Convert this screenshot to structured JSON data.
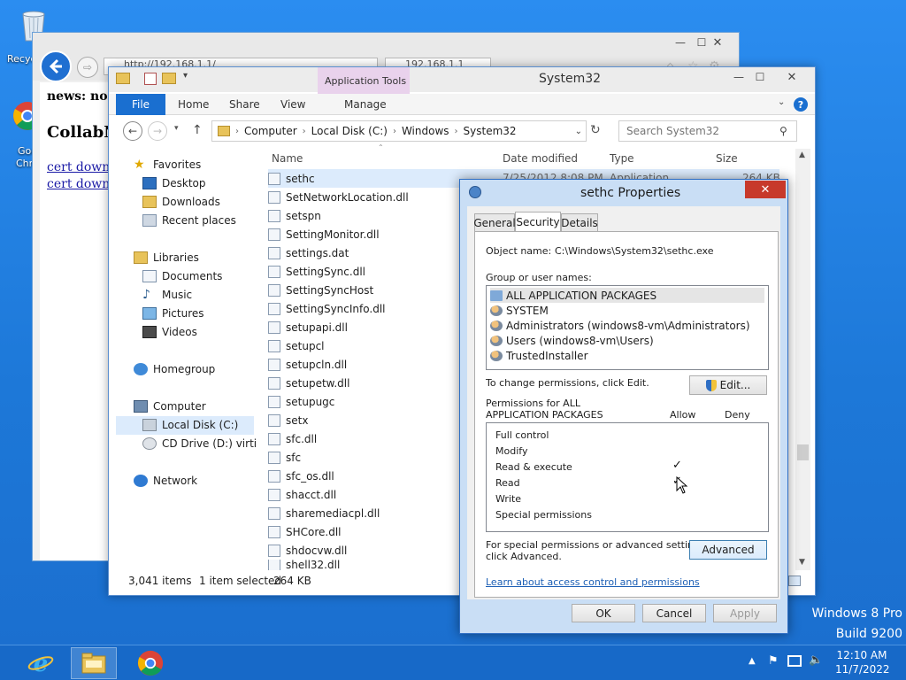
{
  "desktop": {
    "icons": [
      {
        "label": "Recyc"
      },
      {
        "label": "Goo"
      },
      {
        "label": "Chro"
      }
    ],
    "watermark": {
      "line1": "Windows 8 Pro",
      "line2": "Build 9200"
    }
  },
  "browser": {
    "address": "http://192.168.1.1/",
    "tab_address": "192.168.1.1",
    "page": {
      "news": "news: no n",
      "heading": "CollabNe",
      "links": [
        "cert downlo",
        "cert downlo"
      ]
    }
  },
  "explorer": {
    "title": "System32",
    "contextual_tab": "Application Tools",
    "ribbon_tabs": {
      "file": "File",
      "home": "Home",
      "share": "Share",
      "view": "View",
      "manage": "Manage"
    },
    "breadcrumb": [
      "Computer",
      "Local Disk (C:)",
      "Windows",
      "System32"
    ],
    "search_placeholder": "Search System32",
    "nav": {
      "favorites": "Favorites",
      "desktop": "Desktop",
      "downloads": "Downloads",
      "recent": "Recent places",
      "libraries": "Libraries",
      "documents": "Documents",
      "music": "Music",
      "pictures": "Pictures",
      "videos": "Videos",
      "homegroup": "Homegroup",
      "computer": "Computer",
      "local_disk": "Local Disk (C:)",
      "cd_drive": "CD Drive (D:) virtio-w",
      "network": "Network"
    },
    "columns": {
      "name": "Name",
      "date": "Date modified",
      "type": "Type",
      "size": "Size"
    },
    "first_row": {
      "date": "7/25/2012 8:08 PM",
      "type": "Application",
      "size": "264 KB"
    },
    "files": [
      "sethc",
      "SetNetworkLocation.dll",
      "setspn",
      "SettingMonitor.dll",
      "settings.dat",
      "SettingSync.dll",
      "SettingSyncHost",
      "SettingSyncInfo.dll",
      "setupapi.dll",
      "setupcl",
      "setupcln.dll",
      "setupetw.dll",
      "setupugc",
      "setx",
      "sfc.dll",
      "sfc",
      "sfc_os.dll",
      "shacct.dll",
      "sharemediacpl.dll",
      "SHCore.dll",
      "shdocvw.dll",
      "shell32.dll"
    ],
    "status": {
      "items": "3,041 items",
      "selected": "1 item selected",
      "size": "264 KB"
    }
  },
  "dialog": {
    "title": "sethc Properties",
    "tabs": {
      "general": "General",
      "security": "Security",
      "details": "Details"
    },
    "object_label": "Object name:",
    "object_value": "C:\\Windows\\System32\\sethc.exe",
    "group_label": "Group or user names:",
    "users": [
      "ALL APPLICATION PACKAGES",
      "SYSTEM",
      "Administrators (windows8-vm\\Administrators)",
      "Users (windows8-vm\\Users)",
      "TrustedInstaller"
    ],
    "change_text": "To change permissions, click Edit.",
    "edit_button": "Edit...",
    "perm_header_line1": "Permissions for ALL",
    "perm_header_line2": "APPLICATION PACKAGES",
    "allow": "Allow",
    "deny": "Deny",
    "permissions": [
      {
        "name": "Full control",
        "allow": false
      },
      {
        "name": "Modify",
        "allow": false
      },
      {
        "name": "Read & execute",
        "allow": true
      },
      {
        "name": "Read",
        "allow": true
      },
      {
        "name": "Write",
        "allow": false
      },
      {
        "name": "Special permissions",
        "allow": false
      }
    ],
    "check_glyph": "✓",
    "special_line1": "For special permissions or advanced settings,",
    "special_line2": "click Advanced.",
    "advanced_button": "Advanced",
    "learn_link": "Learn about access control and permissions",
    "ok": "OK",
    "cancel": "Cancel",
    "apply": "Apply"
  },
  "taskbar": {
    "time": "12:10 AM",
    "date": "11/7/2022"
  }
}
